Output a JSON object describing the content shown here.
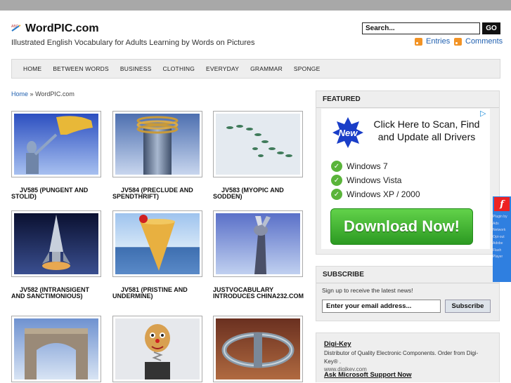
{
  "header": {
    "title": "WordPIC.com",
    "tagline": "Illustrated English Vocabulary for Adults Learning by Words on Pictures",
    "search_placeholder": "Search...",
    "go_label": "GO",
    "entries_label": "Entries",
    "comments_label": "Comments",
    "logo_icon": "abc-pencil-icon"
  },
  "nav": {
    "items": [
      "HOME",
      "BETWEEN WORDS",
      "BUSINESS",
      "CLOTHING",
      "EVERYDAY",
      "GRAMMAR",
      "SPONGE"
    ]
  },
  "breadcrumb": {
    "home": "Home",
    "separator": "»",
    "current": "WordPIC.com"
  },
  "posts": [
    {
      "caption": "JV585 (PUNGENT AND STOLID)",
      "image": "robot-reaching-giant-hand"
    },
    {
      "caption": "JV584 (PRECLUDE AND SPENDTHRIFT)",
      "image": "pillar-with-coiled-rings"
    },
    {
      "caption": "JV583 (MYOPIC AND SODDEN)",
      "image": "spiral-of-green-leaves"
    },
    {
      "caption": "JV582 (INTRANSIGENT AND SANCTIMONIOUS)",
      "image": "rocket-on-launch-pad"
    },
    {
      "caption": "JV581 (PRISTINE AND UNDERMINE)",
      "image": "cone-with-red-ball-over-water"
    },
    {
      "caption": "JUSTVOCABULARY INTRODUCES CHINA232.COM",
      "image": "robotic-arm-holding-figure"
    },
    {
      "caption": "",
      "image": "stone-arch-structure"
    },
    {
      "caption": "",
      "image": "clown-head-on-spring-box"
    },
    {
      "caption": "",
      "image": "spaceship-ring-structure"
    }
  ],
  "sidebar": {
    "featured_title": "FEATURED",
    "ad": {
      "badge": "New",
      "headline": "Click Here to Scan, Find and Update all Drivers",
      "items": [
        "Windows  7",
        "Windows  Vista",
        "Windows  XP / 2000"
      ],
      "button": "Download Now!",
      "adchoices_icon": "adchoices-icon"
    },
    "subscribe_title": "SUBSCRIBE",
    "subscribe_text": "Sign up to receive the latest news!",
    "email_placeholder": "Enter your email address...",
    "subscribe_button": "Subscribe",
    "links": [
      {
        "title": "Digi-Key",
        "desc": "Distributor of Quality Electronic Components. Order from Digi-Key® .",
        "url": "www.digikey.com"
      },
      {
        "title": "Ask Microsoft Support Now",
        "desc": "",
        "url": ""
      }
    ]
  },
  "flash_widget": {
    "icon": "flash-player-icon",
    "text": "Plugin by Ads Network Opt-out Adobe Flash Player"
  },
  "colors": {
    "topbar": "#a8a8a8",
    "link": "#2060b0",
    "nav_bg": "#eeeeee",
    "download_green": "#3cb52e",
    "flash_blue": "#2f7fe0"
  }
}
